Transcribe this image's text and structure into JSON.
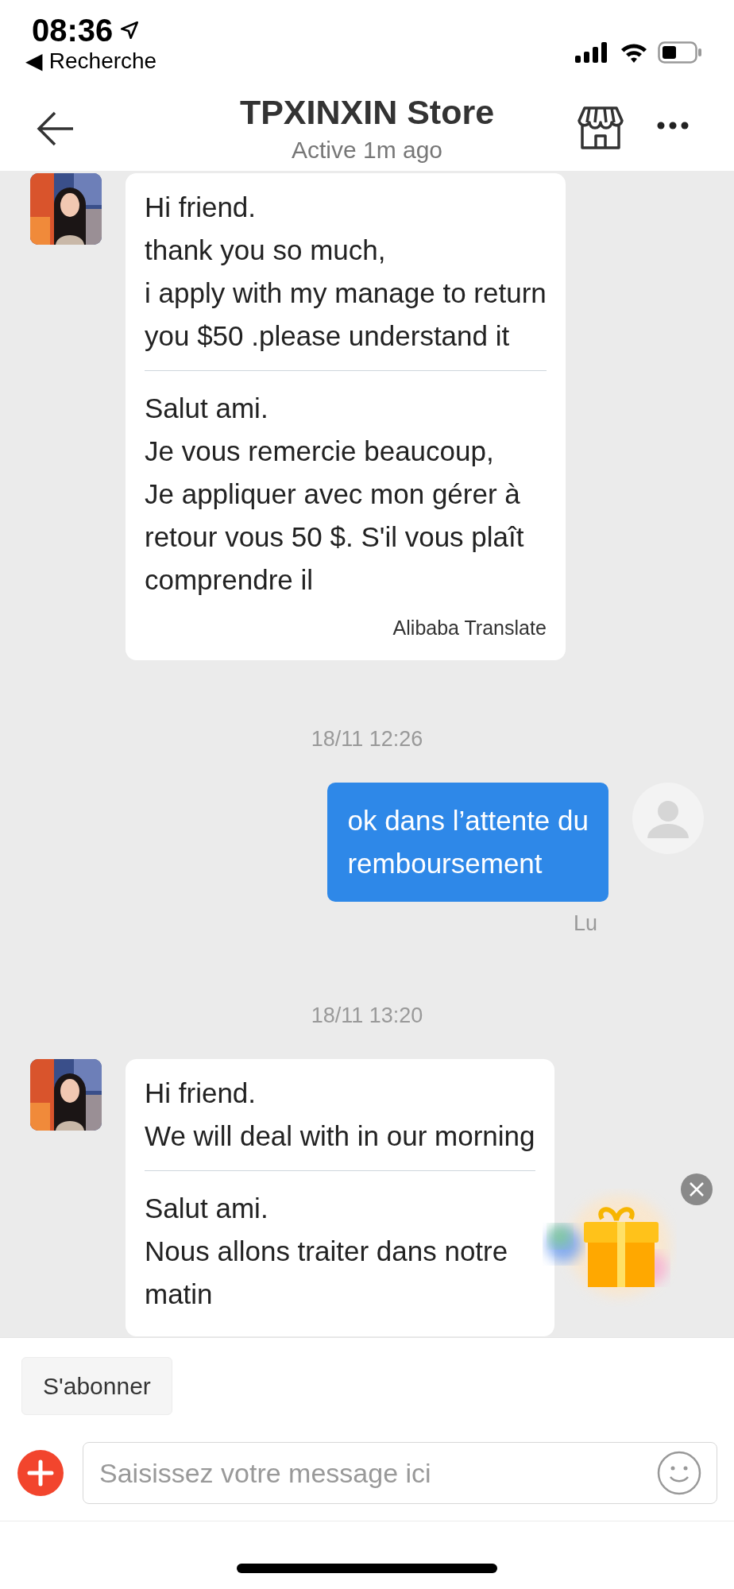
{
  "status_bar": {
    "time": "08:36",
    "back_app": "◀ Recherche"
  },
  "header": {
    "title": "TPXINXIN Store",
    "subtitle": "Active 1m ago"
  },
  "messages": [
    {
      "kind": "incoming",
      "text": "Hi friend.\nthank you so much,\ni apply with my manage to return\nyou $50 .please understand it",
      "translation": "Salut ami.\nJe vous remercie beaucoup,\nJe appliquer avec mon gérer à\nretour vous 50 $. S'il vous plaît\ncomprendre il",
      "credit": "Alibaba Translate"
    },
    {
      "kind": "timestamp",
      "text": "18/11 12:26"
    },
    {
      "kind": "outgoing",
      "text": "ok dans l’attente du\nremboursement",
      "receipt": "Lu"
    },
    {
      "kind": "timestamp",
      "text": "18/11 13:20"
    },
    {
      "kind": "incoming",
      "text": "Hi friend.\nWe will deal with in our morning",
      "translation": "Salut ami.\nNous allons traiter dans notre\nmatin"
    }
  ],
  "quick_actions": [
    "S'abonner"
  ],
  "composer": {
    "placeholder": "Saisissez votre message ici"
  }
}
